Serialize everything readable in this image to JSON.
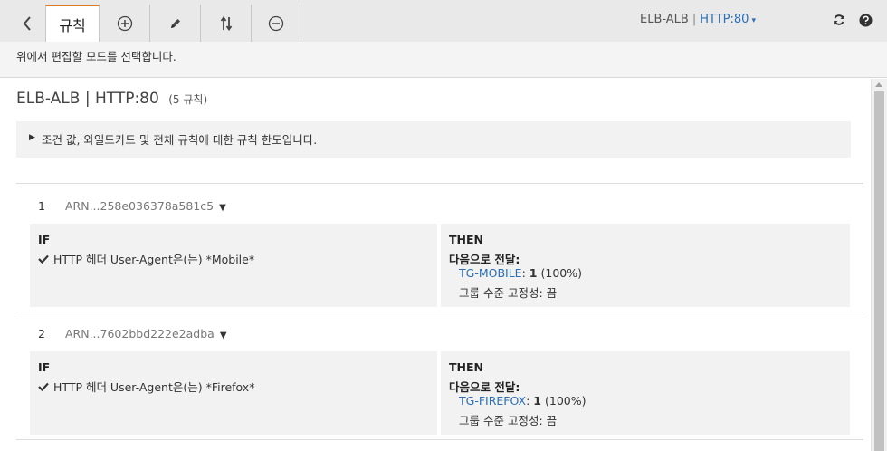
{
  "toolbar": {
    "rules_tab_label": "규칙",
    "listener": {
      "lb_name": "ELB-ALB",
      "separator": "|",
      "protocol": "HTTP:80"
    }
  },
  "hint": "위에서 편집할 모드를 선택합니다.",
  "page": {
    "lb_name": "ELB-ALB",
    "separator": "|",
    "protocol": "HTTP:80",
    "rule_count": "(5 규칙)"
  },
  "limits_text": "조건 값, 와일드카드 및 전체 규칙에 대한 규칙 한도입니다.",
  "icons": {
    "back": "chevron-left-icon",
    "add": "plus-circle-icon",
    "edit": "pencil-icon",
    "reorder": "reorder-arrows-icon",
    "delete": "minus-circle-icon",
    "refresh": "refresh-icon",
    "help": "help-icon",
    "check": "check-icon"
  },
  "colors": {
    "accent_tab": "#e07a1f",
    "link": "#2a6fb7",
    "panel_bg": "#f2f2f2",
    "toolbar_bg": "#e9e9e9"
  },
  "rules": [
    {
      "number": "1",
      "arn": "ARN...258e036378a581c5",
      "if_label": "IF",
      "condition": "HTTP 헤더 User-Agent은(는) *Mobile*",
      "then_label": "THEN",
      "action": "다음으로 전달:",
      "target_group": "TG-MOBILE",
      "target_colon": ":",
      "weight": "1",
      "weight_pct": "(100%)",
      "stickiness": "그룹 수준 고정성: 끔"
    },
    {
      "number": "2",
      "arn": "ARN...7602bbd222e2adba",
      "if_label": "IF",
      "condition": "HTTP 헤더 User-Agent은(는) *Firefox*",
      "then_label": "THEN",
      "action": "다음으로 전달:",
      "target_group": "TG-FIREFOX",
      "target_colon": ":",
      "weight": "1",
      "weight_pct": "(100%)",
      "stickiness": "그룹 수준 고정성: 끔"
    }
  ]
}
